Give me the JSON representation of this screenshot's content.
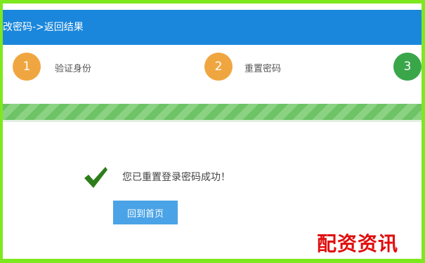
{
  "header": {
    "title": "改密码->返回结果"
  },
  "steps": [
    {
      "number": "1",
      "label": "验证身份",
      "color": "#f0a640"
    },
    {
      "number": "2",
      "label": "重置密码",
      "color": "#f0a640"
    },
    {
      "number": "3",
      "label": "",
      "color": "#3aa64a"
    }
  ],
  "progress": {
    "value_percent": 100,
    "color": "#7ccb74"
  },
  "result": {
    "message": "您已重置登录密码成功！",
    "icon": "check-icon",
    "icon_color": "#2e7d1b"
  },
  "buttons": {
    "home_label": "回到首页"
  },
  "watermark": {
    "text": "配资资讯"
  },
  "colors": {
    "header": "#1a87dc",
    "button": "#4aa3e6",
    "frame": "#7ee81f"
  }
}
